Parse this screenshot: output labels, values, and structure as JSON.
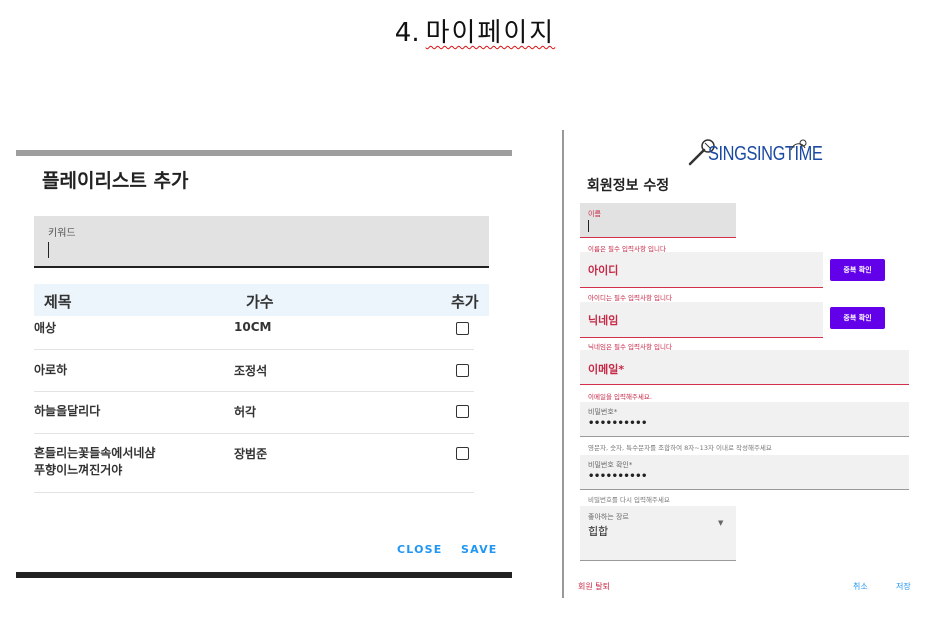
{
  "page": {
    "number": "4.",
    "title": "마이페이지"
  },
  "playlist_dialog": {
    "title": "플레이리스트 추가",
    "keyword_label": "키워드",
    "keyword_value": "",
    "columns": {
      "title": "제목",
      "singer": "가수",
      "add": "추가"
    },
    "rows": [
      {
        "title": "애상",
        "singer": "10CM",
        "checked": false
      },
      {
        "title": "아로하",
        "singer": "조정석",
        "checked": false
      },
      {
        "title": "하늘을달리다",
        "singer": "허각",
        "checked": false
      },
      {
        "title_line1": "흔들리는꽃들속에서네샴",
        "title_line2": "푸향이느껴진거야",
        "singer": "장범준",
        "checked": false
      }
    ],
    "close_label": "CLOSE",
    "save_label": "SAVE"
  },
  "member_form": {
    "logo_text": "SINGSINGTIME",
    "title": "회원정보 수정",
    "name": {
      "label": "이름",
      "value": "",
      "helper": "이름은 필수 입력사항 입니다"
    },
    "id": {
      "label": "아이디",
      "helper": "아이디는 필수 입력사항 입니다",
      "button": "중복 확인"
    },
    "nickname": {
      "label": "닉네임",
      "helper": "닉네임은 필수 입력사항 입니다",
      "button": "중복 확인"
    },
    "email": {
      "label": "이메일*",
      "helper": "이메일을 입력해주세요."
    },
    "password": {
      "label": "비밀번호*",
      "value": "••••••••••",
      "helper": "영문자, 숫자, 특수문자를 조합하여 8자~13자 이내로 작성해주세요"
    },
    "password_confirm": {
      "label": "비밀번호 확인*",
      "value": "••••••••••",
      "helper": "비밀번호를 다시 입력해주세요"
    },
    "genre": {
      "label": "좋아하는 장르",
      "value": "힙합"
    },
    "withdraw_label": "회원 탈퇴",
    "cancel_label": "취소",
    "save_label": "저장"
  },
  "colors": {
    "accent_blue": "#2196f3",
    "error_red": "#c62846",
    "purple": "#6200ea",
    "logo_blue": "#1a4aa3"
  }
}
